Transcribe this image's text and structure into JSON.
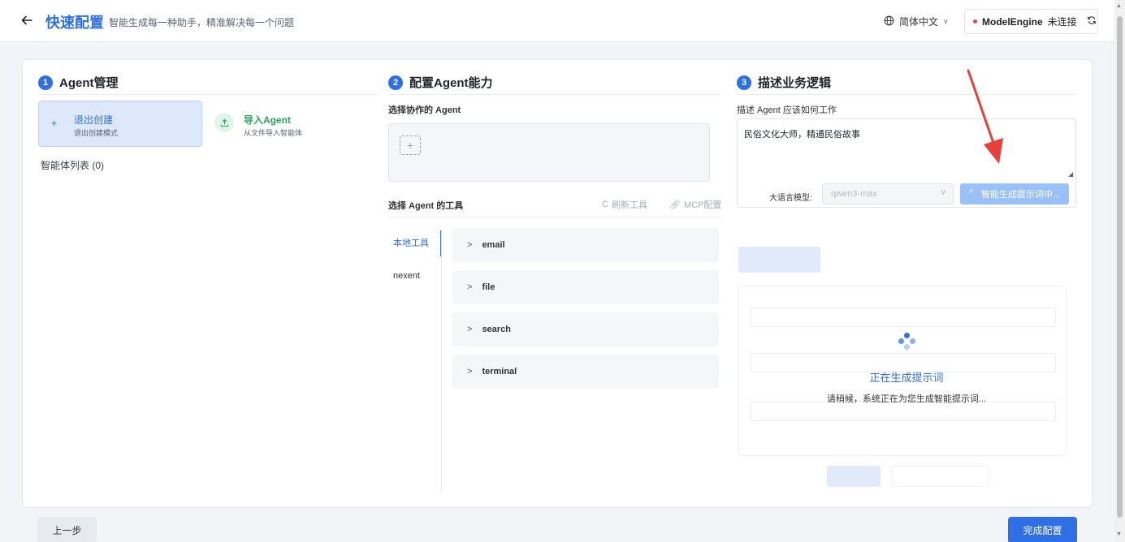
{
  "header": {
    "title": "快速配置",
    "subtitle": "智能生成每一种助手，精准解决每一个问题",
    "language": "简体中文",
    "connection_name": "ModelEngine",
    "connection_status": "未连接"
  },
  "steps": [
    {
      "number": "1",
      "title": "Agent管理"
    },
    {
      "number": "2",
      "title": "配置Agent能力"
    },
    {
      "number": "3",
      "title": "描述业务逻辑"
    }
  ],
  "agent_mgmt": {
    "exit_title": "退出创建",
    "exit_desc": "退出创建模式",
    "import_title": "导入Agent",
    "import_desc": "从文件导入智能体",
    "list_label": "智能体列表 (0)"
  },
  "capabilities": {
    "collab_label": "选择协作的 Agent",
    "tools_label": "选择 Agent 的工具",
    "refresh_tools": "刷新工具",
    "mcp_config": "MCP配置",
    "tool_tabs": [
      "本地工具",
      "nexent"
    ],
    "tools": [
      "email",
      "file",
      "search",
      "terminal"
    ]
  },
  "business": {
    "desc_label": "描述 Agent 应该如何工作",
    "desc_value": "民俗文化大师，精通民俗故事",
    "model_label": "大语言模型:",
    "model_value": "qwen3-max",
    "generate_button": "智能生成提示词中..."
  },
  "loading": {
    "title": "正在生成提示词",
    "subtitle": "请稍候，系统正在为您生成智能提示词..."
  },
  "footer": {
    "prev": "上一步",
    "done": "完成配置"
  },
  "colors": {
    "primary": "#2f6fe6",
    "success": "#2aa35f",
    "danger": "#e5484d",
    "annotation": "#e8403a"
  }
}
